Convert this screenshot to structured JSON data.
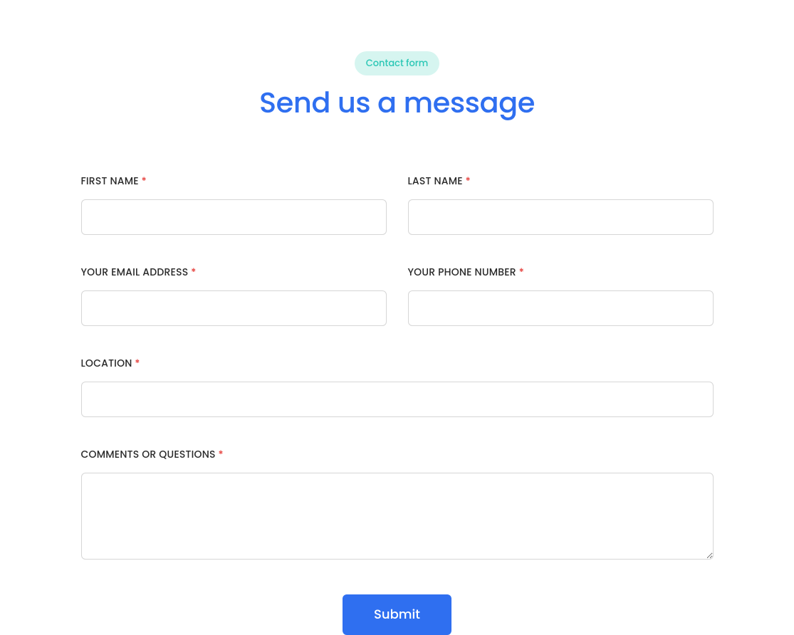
{
  "header": {
    "badge": "Contact form",
    "title": "Send us a message"
  },
  "form": {
    "fields": {
      "first_name": {
        "label": "First Name",
        "required": true,
        "value": ""
      },
      "last_name": {
        "label": "Last Name",
        "required": true,
        "value": ""
      },
      "email": {
        "label": "Your Email Address",
        "required": true,
        "value": ""
      },
      "phone": {
        "label": "Your Phone Number",
        "required": true,
        "value": ""
      },
      "location": {
        "label": "Location",
        "required": true,
        "value": ""
      },
      "comments": {
        "label": "Comments or Questions",
        "required": true,
        "value": ""
      }
    },
    "required_marker": "*",
    "submit_label": "Submit"
  }
}
